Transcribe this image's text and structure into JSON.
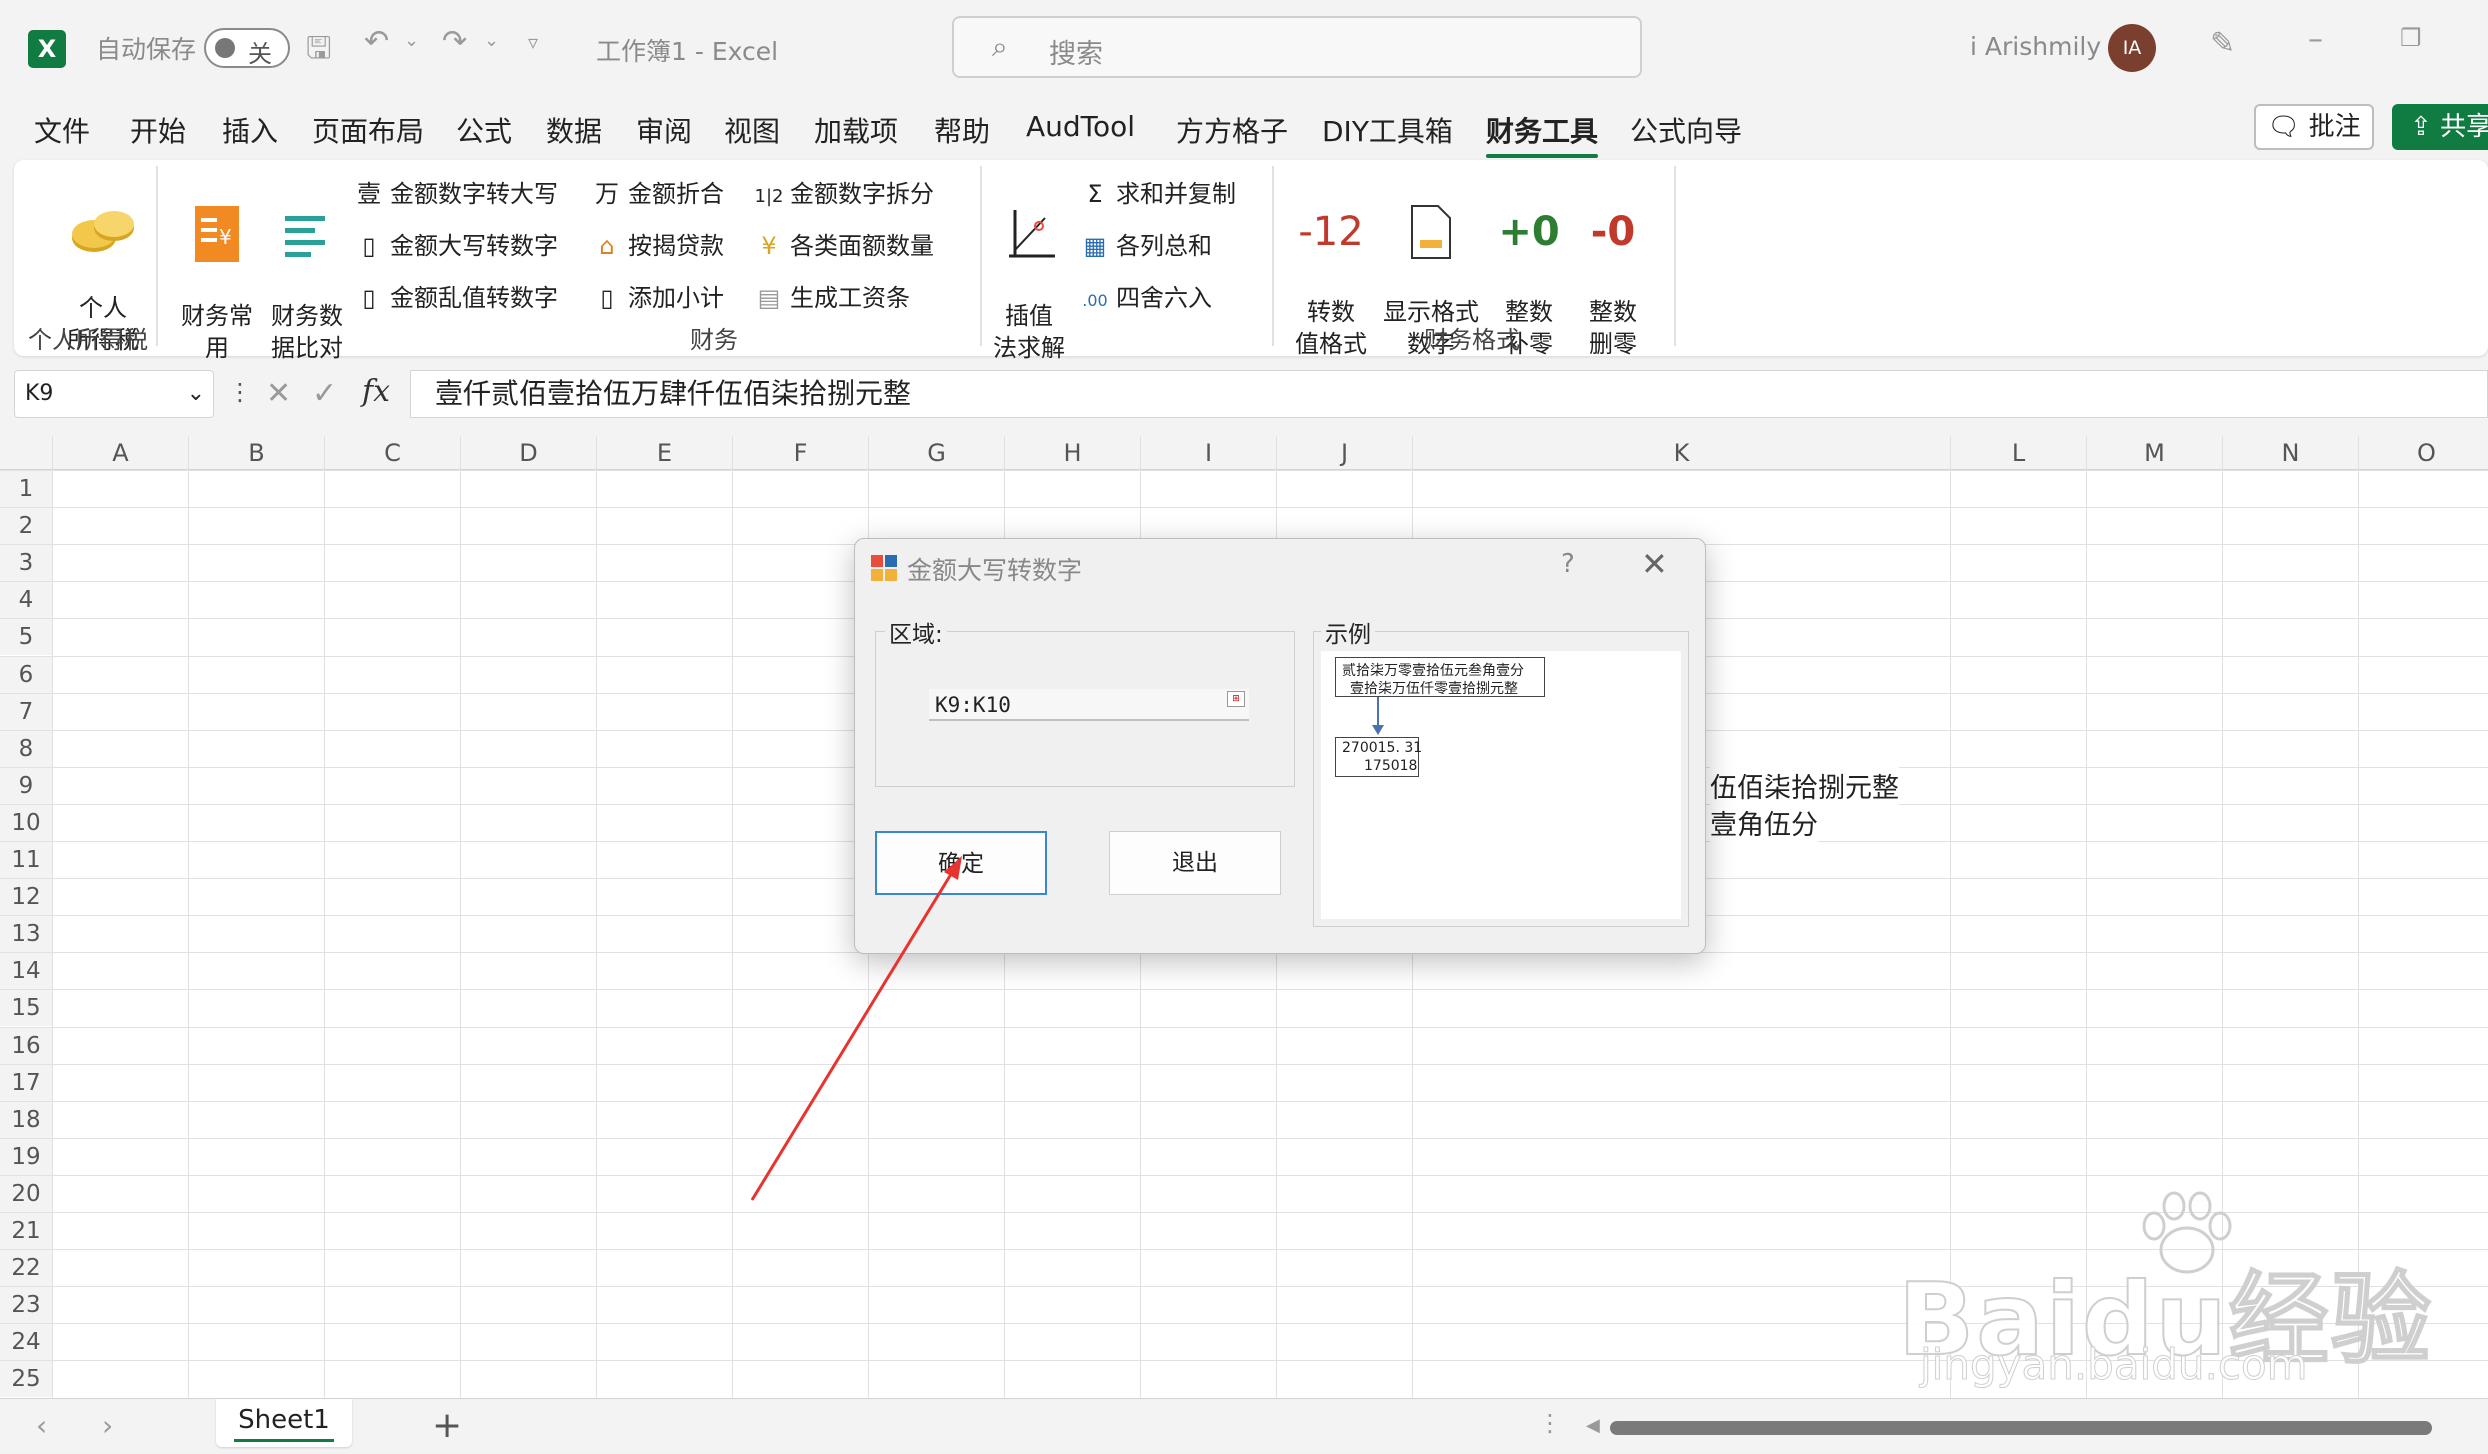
{
  "titlebar": {
    "autosave_label": "自动保存",
    "autosave_state": "关",
    "doc_title": "工作簿1  -  Excel",
    "search_placeholder": "搜索",
    "user_name": "i Arishmily",
    "avatar_initials": "IA"
  },
  "menu": {
    "tabs": [
      "文件",
      "开始",
      "插入",
      "页面布局",
      "公式",
      "数据",
      "审阅",
      "视图",
      "加载项",
      "帮助",
      "AudTool",
      "方方格子",
      "DIY工具箱",
      "财务工具",
      "公式向导"
    ],
    "active_tab": "财务工具",
    "comment_btn": "批注",
    "share_btn": "共享"
  },
  "ribbon": {
    "personal_tax": "个人\n所得税",
    "personal_tax_group": "个人所得税",
    "finance_common": "财务常\n用",
    "finance_compare": "财务数\n据比对",
    "col1": [
      "金额数字转大写",
      "金额大写转数字",
      "金额乱值转数字"
    ],
    "col2": [
      "金额折合",
      "按揭贷款",
      "添加小计"
    ],
    "col3": [
      "金额数字拆分",
      "各类面额数量",
      "生成工资条"
    ],
    "finance_group": "财务",
    "interp": "插值\n法求解",
    "col4": [
      "求和并复制",
      "各列总和",
      "四舍六入"
    ],
    "convert_format": "转数\n值格式",
    "show_format": "显示格式\n数字",
    "int_pad": "整数\n补零",
    "int_del": "整数\n删零",
    "icon_convert": "-12",
    "icon_pad": "+0",
    "icon_del": "-0",
    "format_group": "财务格式"
  },
  "formula_bar": {
    "name_box": "K9",
    "formula": "壹仟贰佰壹拾伍万肆仟伍佰柒拾捌元整"
  },
  "grid": {
    "columns": [
      "A",
      "B",
      "C",
      "D",
      "E",
      "F",
      "G",
      "H",
      "I",
      "J",
      "K",
      "L",
      "M",
      "N",
      "O"
    ],
    "rows": [
      "1",
      "2",
      "3",
      "4",
      "5",
      "6",
      "7",
      "8",
      "9",
      "10",
      "11",
      "12",
      "13",
      "14",
      "15",
      "16",
      "17",
      "18",
      "19",
      "20",
      "21",
      "22",
      "23",
      "24",
      "25"
    ],
    "k9_visible": "伍佰柒拾捌元整",
    "k10_visible": "壹角伍分"
  },
  "sheets": {
    "active": "Sheet1"
  },
  "dialog": {
    "title": "金额大写转数字",
    "help": "?",
    "region_label": "区域:",
    "region_value": "K9:K10",
    "example_label": "示例",
    "example_line1": "贰拾柒万零壹拾伍元叁角壹分",
    "example_line2": "壹拾柒万伍仟零壹拾捌元整",
    "example_num1": "270015. 31",
    "example_num2": "175018",
    "ok_label": "确定",
    "exit_label": "退出"
  },
  "watermark": {
    "main": "Baidu经验",
    "sub": "jingyan.baidu.com"
  },
  "colors": {
    "excel_green": "#107c41",
    "annotation_red": "#e8332f",
    "ok_border": "#3a86d0"
  }
}
